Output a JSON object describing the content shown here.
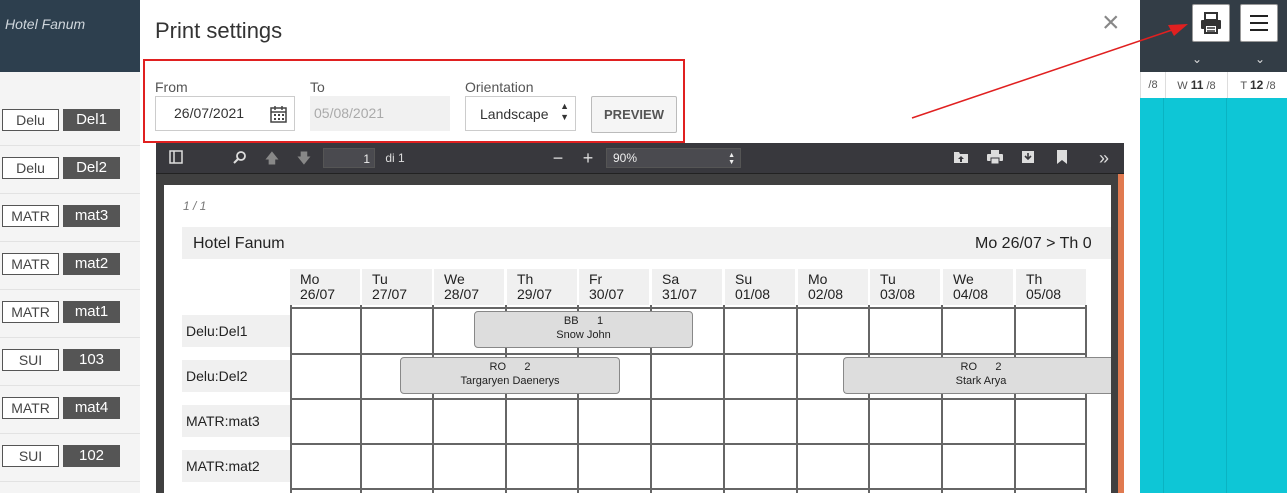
{
  "app": {
    "title": "Hotel Fanum",
    "rooms": [
      {
        "type": "Delu",
        "name": "Del1"
      },
      {
        "type": "Delu",
        "name": "Del2"
      },
      {
        "type": "MATR",
        "name": "mat3"
      },
      {
        "type": "MATR",
        "name": "mat2"
      },
      {
        "type": "MATR",
        "name": "mat1"
      },
      {
        "type": "SUI",
        "name": "103"
      },
      {
        "type": "MATR",
        "name": "mat4"
      },
      {
        "type": "SUI",
        "name": "102"
      }
    ],
    "day_headers": [
      {
        "suffix": "/8"
      },
      {
        "wd": "W",
        "num": "11",
        "suffix": "/8"
      },
      {
        "wd": "T",
        "num": "12",
        "suffix": "/8"
      }
    ]
  },
  "modal": {
    "title": "Print settings",
    "close_label": "×",
    "from_label": "From",
    "from_value": "26/07/2021",
    "to_label": "To",
    "to_value": "05/08/2021",
    "orientation_label": "Orientation",
    "orientation_value": "Landscape",
    "preview_label": "PREVIEW"
  },
  "pdf": {
    "page_number": "1",
    "page_total": "di 1",
    "zoom": "90%",
    "page_counter": "1 / 1",
    "schedule": {
      "hotel": "Hotel Fanum",
      "range": "Mo 26/07 > Th 0",
      "days": [
        {
          "wd": "Mo",
          "date": "26/07"
        },
        {
          "wd": "Tu",
          "date": "27/07"
        },
        {
          "wd": "We",
          "date": "28/07"
        },
        {
          "wd": "Th",
          "date": "29/07"
        },
        {
          "wd": "Fr",
          "date": "30/07"
        },
        {
          "wd": "Sa",
          "date": "31/07"
        },
        {
          "wd": "Su",
          "date": "01/08"
        },
        {
          "wd": "Mo",
          "date": "02/08"
        },
        {
          "wd": "Tu",
          "date": "03/08"
        },
        {
          "wd": "We",
          "date": "04/08"
        },
        {
          "wd": "Th",
          "date": "05/08"
        }
      ],
      "rows": [
        "Delu:Del1",
        "Delu:Del2",
        "MATR:mat3",
        "MATR:mat2"
      ],
      "bookings": [
        {
          "code": "BB",
          "count": "1",
          "guest": "Snow John"
        },
        {
          "code": "RO",
          "count": "2",
          "guest": "Targaryen Daenerys"
        },
        {
          "code": "RO",
          "count": "2",
          "guest": "Stark Arya"
        }
      ]
    }
  },
  "colors": {
    "header_bg": "#2d3f4e",
    "accent_teal": "#0ec6d6",
    "highlight_red": "#e02020",
    "annotation_arrow": "#e02020"
  }
}
